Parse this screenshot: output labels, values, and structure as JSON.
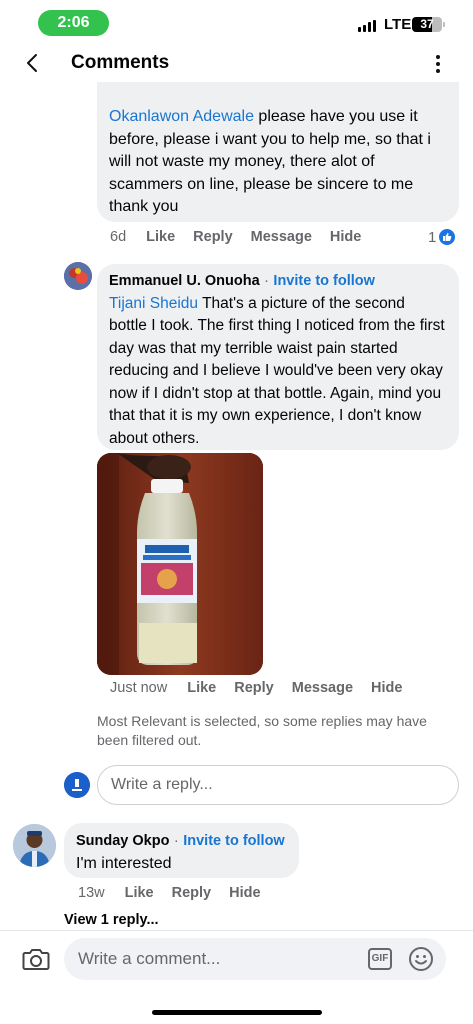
{
  "status_bar": {
    "time": "2:06",
    "network": "LTE",
    "battery": "37"
  },
  "header": {
    "title": "Comments"
  },
  "comment1": {
    "mention": "Okanlawon Adewale",
    "text": " please have you use it before, please i want you to help me, so that i will not waste my money, there alot of scammers on line, please be sincere to me thank you",
    "time": "6d",
    "like": "Like",
    "reply": "Reply",
    "message": "Message",
    "hide": "Hide",
    "reaction_count": "1"
  },
  "comment2": {
    "author": "Emmanuel U. Onuoha",
    "separator": "·",
    "follow": "Invite to follow",
    "mention": "Tijani Sheidu",
    "text": " That's a picture of the second bottle I took. The first thing I noticed from the first day was that my terrible waist pain started reducing and I believe I would've been very okay now if I didn't stop at that bottle. Again, mind you that that it is my own experience, I don't know about others.",
    "bottle_label": "DR ADAMS HERBAL MIXTURE",
    "time": "Just now",
    "like": "Like",
    "reply": "Reply",
    "message": "Message",
    "hide": "Hide"
  },
  "filter_note": "Most Relevant is selected, so some replies may have been filtered out.",
  "reply_input": {
    "placeholder": "Write a reply..."
  },
  "comment3": {
    "author": "Sunday Okpo",
    "separator": "·",
    "follow": "Invite to follow",
    "text": "I'm interested",
    "time": "13w",
    "like": "Like",
    "reply": "Reply",
    "hide": "Hide"
  },
  "view_replies": "View 1 reply...",
  "composer": {
    "placeholder": "Write a comment...",
    "gif": "GIF"
  },
  "colors": {
    "link": "#1876d2",
    "bubble": "#eff0f2",
    "status_pill": "#32c24d"
  }
}
